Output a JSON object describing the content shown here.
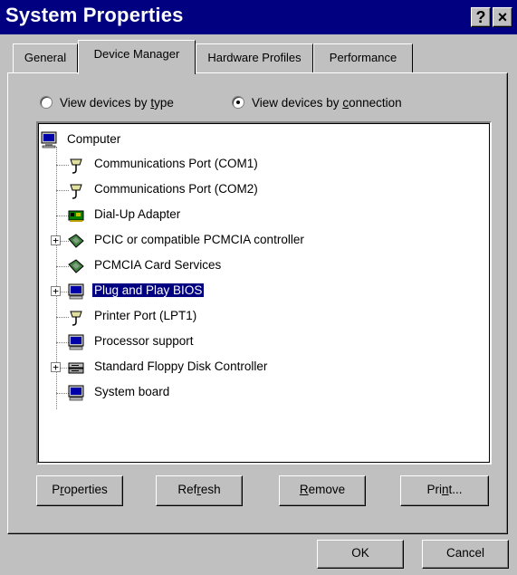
{
  "window": {
    "title": "System Properties",
    "help_glyph": "?",
    "close_glyph": "×"
  },
  "tabs": [
    {
      "label": "General",
      "active": false
    },
    {
      "label": "Device Manager",
      "active": true
    },
    {
      "label": "Hardware Profiles",
      "active": false
    },
    {
      "label": "Performance",
      "active": false
    }
  ],
  "view_mode": {
    "by_type": {
      "pre": "View devices by ",
      "u": "t",
      "post": "ype",
      "selected": false
    },
    "by_connection": {
      "pre": "View devices by ",
      "u": "c",
      "post": "onnection",
      "selected": true
    }
  },
  "tree": {
    "root": {
      "label": "Computer",
      "icon": "computer-icon"
    },
    "items": [
      {
        "label": "Communications Port (COM1)",
        "icon": "port-icon",
        "expandable": false,
        "selected": false
      },
      {
        "label": "Communications Port (COM2)",
        "icon": "port-icon",
        "expandable": false,
        "selected": false
      },
      {
        "label": "Dial-Up Adapter",
        "icon": "network-adapter-icon",
        "expandable": false,
        "selected": false
      },
      {
        "label": "PCIC or compatible PCMCIA controller",
        "icon": "pcmcia-icon",
        "expandable": true,
        "selected": false
      },
      {
        "label": "PCMCIA Card Services",
        "icon": "pcmcia-icon",
        "expandable": false,
        "selected": false
      },
      {
        "label": "Plug and Play BIOS",
        "icon": "monitor-icon",
        "expandable": true,
        "selected": true
      },
      {
        "label": "Printer Port (LPT1)",
        "icon": "port-icon",
        "expandable": false,
        "selected": false
      },
      {
        "label": "Processor support",
        "icon": "monitor-icon",
        "expandable": false,
        "selected": false
      },
      {
        "label": "Standard Floppy Disk Controller",
        "icon": "floppy-controller-icon",
        "expandable": true,
        "selected": false
      },
      {
        "label": "System board",
        "icon": "monitor-icon",
        "expandable": false,
        "selected": false
      }
    ],
    "expander_glyph": "+"
  },
  "actions": {
    "properties": {
      "pre": "P",
      "u": "r",
      "post": "operties"
    },
    "refresh": {
      "pre": "Ref",
      "u": "r",
      "post": "esh"
    },
    "remove": {
      "pre": "",
      "u": "R",
      "post": "emove"
    },
    "print": {
      "pre": "Pri",
      "u": "n",
      "post": "t..."
    }
  },
  "footer": {
    "ok": "OK",
    "cancel": "Cancel"
  },
  "colors": {
    "titlebar": "#000080",
    "face": "#c0c0c0",
    "selection": "#000080"
  }
}
